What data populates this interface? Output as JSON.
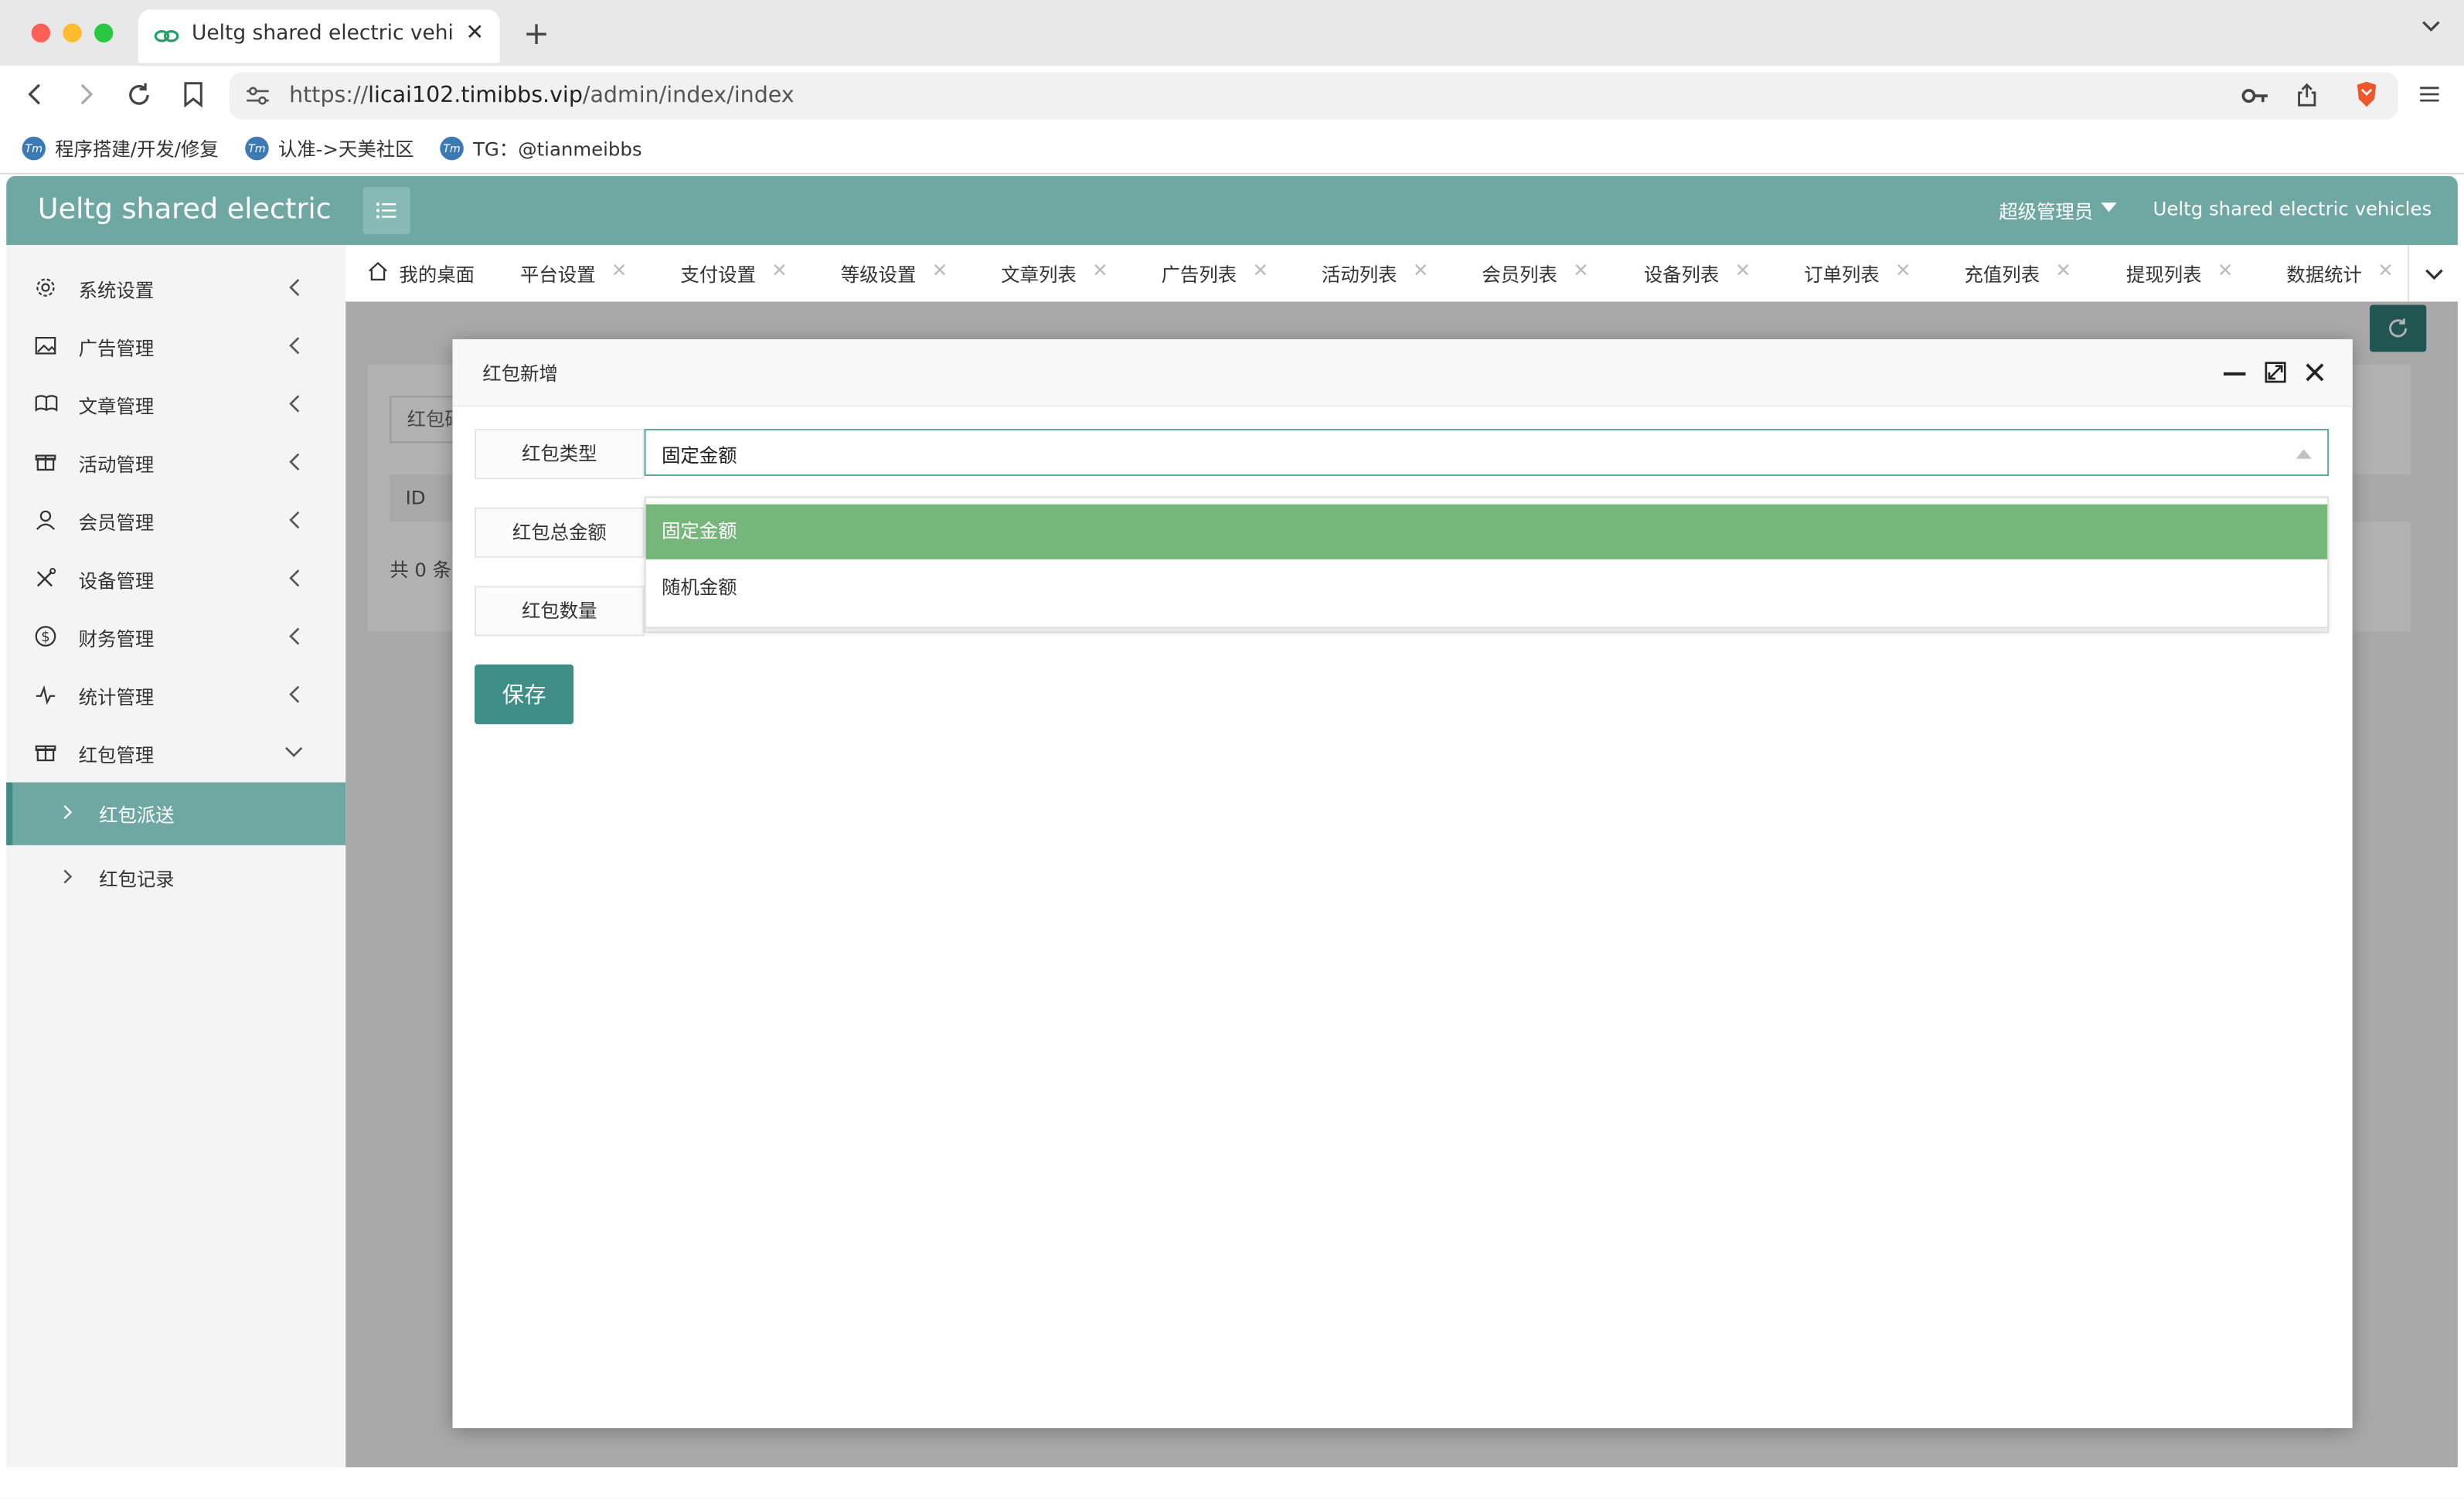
{
  "browser": {
    "tab_title": "Ueltg shared electric vehicles",
    "tab_close": "✕",
    "new_tab": "+",
    "url_scheme": "https://",
    "url_host": "licai102.timibbs.vip",
    "url_path": "/admin/index/index",
    "bookmarks": [
      "程序搭建/开发/修复",
      "认准->天美社区",
      "TG：@tianmeibbs"
    ],
    "bookmark_icon_text": "Tm"
  },
  "header": {
    "logo": "Ueltg shared electric",
    "admin": "超级管理员",
    "site_name": "Ueltg shared electric vehicles"
  },
  "sidebar": {
    "items": [
      {
        "label": "系统设置",
        "icon": "gear-icon"
      },
      {
        "label": "广告管理",
        "icon": "image-icon"
      },
      {
        "label": "文章管理",
        "icon": "book-icon"
      },
      {
        "label": "活动管理",
        "icon": "gift-icon"
      },
      {
        "label": "会员管理",
        "icon": "user-icon"
      },
      {
        "label": "设备管理",
        "icon": "tools-icon"
      },
      {
        "label": "财务管理",
        "icon": "dollar-icon"
      },
      {
        "label": "统计管理",
        "icon": "pulse-icon"
      },
      {
        "label": "红包管理",
        "icon": "gift-icon"
      }
    ],
    "sub_items": [
      {
        "label": "红包派送",
        "active": true
      },
      {
        "label": "红包记录",
        "active": false
      }
    ]
  },
  "page_tabs": {
    "home": "我的桌面",
    "close_glyph": "✕",
    "tabs": [
      "平台设置",
      "支付设置",
      "等级设置",
      "文章列表",
      "广告列表",
      "活动列表",
      "会员列表",
      "设备列表",
      "订单列表",
      "充值列表",
      "提现列表",
      "数据统计"
    ]
  },
  "background_page": {
    "search_placeholder": "红包码",
    "column_id": "ID",
    "total": "共 0 条"
  },
  "modal": {
    "title": "红包新增",
    "fields": {
      "type_label": "红包类型",
      "type_value": "固定金额",
      "amount_label": "红包总金额",
      "count_label": "红包数量"
    },
    "options": [
      "固定金额",
      "随机金额"
    ],
    "save": "保存"
  },
  "colors": {
    "brand": "#6fa8a3",
    "button": "#3e8d86",
    "option_selected": "#77b67a"
  }
}
